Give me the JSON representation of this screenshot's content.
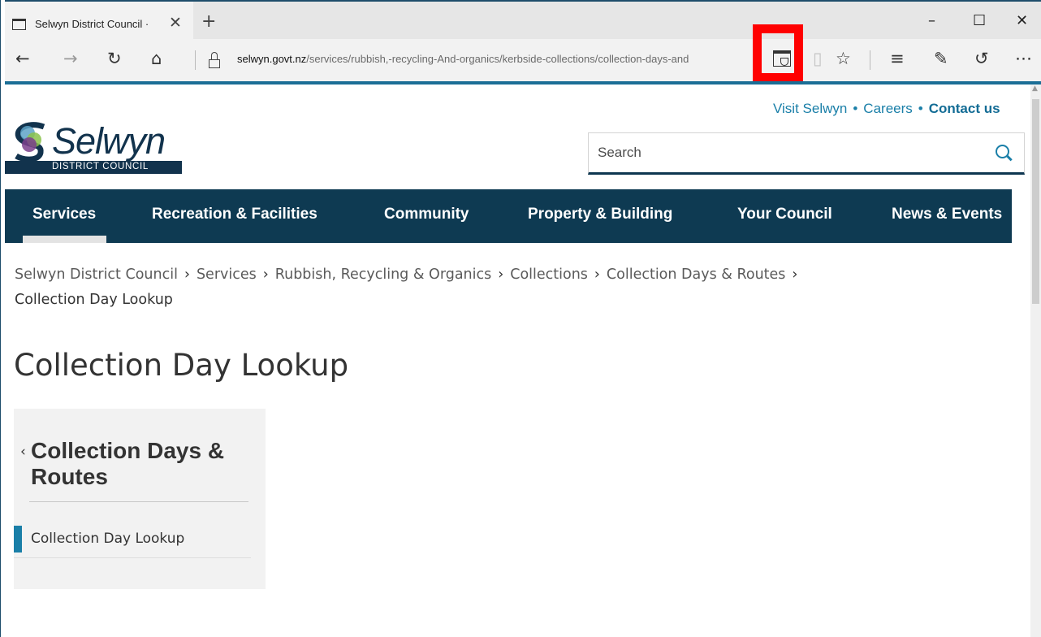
{
  "browser": {
    "tab_title": "Selwyn District Council ·",
    "tab_close": "✕",
    "new_tab": "+",
    "window_controls": {
      "minimize": "–",
      "maximize": "☐",
      "close": "✕"
    },
    "nav": {
      "back": "←",
      "forward": "→",
      "refresh": "↻",
      "home": "⌂"
    },
    "url_host": "selwyn.govt.nz",
    "url_path": "/services/rubbish,-recycling-And-organics/kerbside-collections/collection-days-and",
    "toolbar": {
      "favorite": "☆",
      "hub": "≡",
      "web_note": "✎",
      "share": "↺",
      "more": "⋯"
    },
    "highlight_color": "#ff0000"
  },
  "site": {
    "utility_links": [
      "Visit Selwyn",
      "Careers",
      "Contact us"
    ],
    "utility_sep": "•",
    "logo_word": "Selwyn",
    "logo_sub": "DISTRICT COUNCIL",
    "search_placeholder": "Search",
    "main_nav": [
      "Services",
      "Recreation & Facilities",
      "Community",
      "Property & Building",
      "Your Council",
      "News & Events"
    ],
    "active_nav": "Services",
    "colors": {
      "nav_bg": "#0e3a52",
      "accent": "#1a7fa8",
      "logo": "#12334d"
    }
  },
  "breadcrumb": {
    "items": [
      "Selwyn District Council",
      "Services",
      "Rubbish, Recycling & Organics",
      "Collections",
      "Collection Days & Routes"
    ],
    "sep": "›",
    "current": "Collection Day Lookup"
  },
  "page_title": "Collection Day Lookup",
  "side_nav": {
    "back_glyph": "‹",
    "heading": "Collection Days & Routes",
    "items": [
      "Collection Day Lookup"
    ]
  }
}
